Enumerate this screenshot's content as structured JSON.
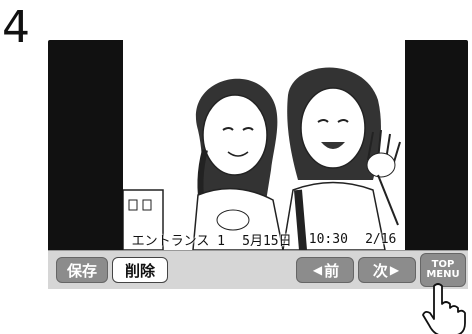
{
  "step": {
    "number": "4"
  },
  "photo": {
    "overlay": {
      "location": "エントランス 1",
      "date": "5月15日",
      "time": "10:30",
      "page": "2/16"
    }
  },
  "toolbar": {
    "save_label": "保存",
    "delete_label": "削除",
    "prev_label": "前",
    "next_label": "次",
    "top_menu_line1": "TOP",
    "top_menu_line2": "MENU"
  },
  "icons": {
    "prev": "left-triangle-icon",
    "next": "right-triangle-icon",
    "pointer": "hand-pointer-icon"
  }
}
